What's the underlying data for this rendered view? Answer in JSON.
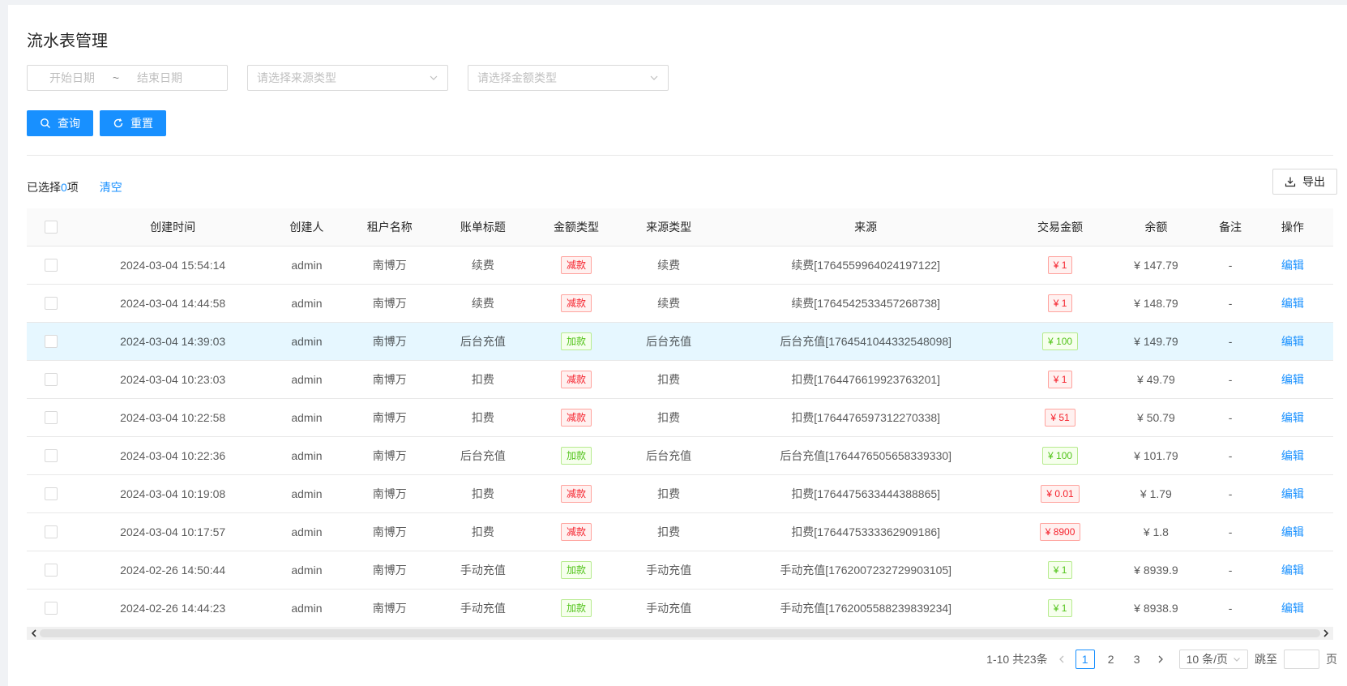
{
  "page": {
    "title": "流水表管理"
  },
  "filters": {
    "start_date_placeholder": "开始日期",
    "range_separator": "~",
    "end_date_placeholder": "结束日期",
    "source_type_placeholder": "请选择来源类型",
    "amount_type_placeholder": "请选择金额类型"
  },
  "actions": {
    "query_label": "查询",
    "reset_label": "重置",
    "export_label": "导出"
  },
  "selection": {
    "prefix": "已选择 ",
    "count": "0",
    "suffix": "项",
    "clear_label": "清空"
  },
  "table": {
    "columns": [
      "创建时间",
      "创建人",
      "租户名称",
      "账单标题",
      "金额类型",
      "来源类型",
      "来源",
      "交易金额",
      "余额",
      "备注",
      "操作"
    ],
    "rows": [
      {
        "created": "2024-03-04 15:54:14",
        "creator": "admin",
        "tenant": "南博万",
        "title": "续费",
        "amount_type": "减款",
        "source_type": "续费",
        "source": "续费[1764559964024197122]",
        "amount": "¥ 1",
        "balance": "¥ 147.79",
        "note": "-",
        "action": "编辑"
      },
      {
        "created": "2024-03-04 14:44:58",
        "creator": "admin",
        "tenant": "南博万",
        "title": "续费",
        "amount_type": "减款",
        "source_type": "续费",
        "source": "续费[1764542533457268738]",
        "amount": "¥ 1",
        "balance": "¥ 148.79",
        "note": "-",
        "action": "编辑"
      },
      {
        "created": "2024-03-04 14:39:03",
        "creator": "admin",
        "tenant": "南博万",
        "title": "后台充值",
        "amount_type": "加款",
        "source_type": "后台充值",
        "source": "后台充值[1764541044332548098]",
        "amount": "¥ 100",
        "balance": "¥ 149.79",
        "note": "-",
        "action": "编辑"
      },
      {
        "created": "2024-03-04 10:23:03",
        "creator": "admin",
        "tenant": "南博万",
        "title": "扣费",
        "amount_type": "减款",
        "source_type": "扣费",
        "source": "扣费[1764476619923763201]",
        "amount": "¥ 1",
        "balance": "¥ 49.79",
        "note": "-",
        "action": "编辑"
      },
      {
        "created": "2024-03-04 10:22:58",
        "creator": "admin",
        "tenant": "南博万",
        "title": "扣费",
        "amount_type": "减款",
        "source_type": "扣费",
        "source": "扣费[1764476597312270338]",
        "amount": "¥ 51",
        "balance": "¥ 50.79",
        "note": "-",
        "action": "编辑"
      },
      {
        "created": "2024-03-04 10:22:36",
        "creator": "admin",
        "tenant": "南博万",
        "title": "后台充值",
        "amount_type": "加款",
        "source_type": "后台充值",
        "source": "后台充值[1764476505658339330]",
        "amount": "¥ 100",
        "balance": "¥ 101.79",
        "note": "-",
        "action": "编辑"
      },
      {
        "created": "2024-03-04 10:19:08",
        "creator": "admin",
        "tenant": "南博万",
        "title": "扣费",
        "amount_type": "减款",
        "source_type": "扣费",
        "source": "扣费[1764475633444388865]",
        "amount": "¥ 0.01",
        "balance": "¥ 1.79",
        "note": "-",
        "action": "编辑"
      },
      {
        "created": "2024-03-04 10:17:57",
        "creator": "admin",
        "tenant": "南博万",
        "title": "扣费",
        "amount_type": "减款",
        "source_type": "扣费",
        "source": "扣费[1764475333362909186]",
        "amount": "¥ 8900",
        "balance": "¥ 1.8",
        "note": "-",
        "action": "编辑"
      },
      {
        "created": "2024-02-26 14:50:44",
        "creator": "admin",
        "tenant": "南博万",
        "title": "手动充值",
        "amount_type": "加款",
        "source_type": "手动充值",
        "source": "手动充值[1762007232729903105]",
        "amount": "¥ 1",
        "balance": "¥ 8939.9",
        "note": "-",
        "action": "编辑"
      },
      {
        "created": "2024-02-26 14:44:23",
        "creator": "admin",
        "tenant": "南博万",
        "title": "手动充值",
        "amount_type": "加款",
        "source_type": "手动充值",
        "source": "手动充值[1762005588239839234]",
        "amount": "¥ 1",
        "balance": "¥ 8938.9",
        "note": "-",
        "action": "编辑"
      }
    ]
  },
  "pagination": {
    "total_text": "1-10 共23条",
    "pages": [
      "1",
      "2",
      "3"
    ],
    "current": "1",
    "page_size": "10 条/页",
    "jump_prefix": "跳至",
    "jump_suffix": "页"
  },
  "colors": {
    "primary": "#1890ff",
    "minus_tag": "#f5222d",
    "plus_tag": "#52c41a",
    "highlight_row": "#e6f7ff"
  },
  "icons": {
    "query": "search-icon",
    "reset": "reload-icon",
    "export": "download-icon",
    "select": "chevron-down-icon"
  }
}
